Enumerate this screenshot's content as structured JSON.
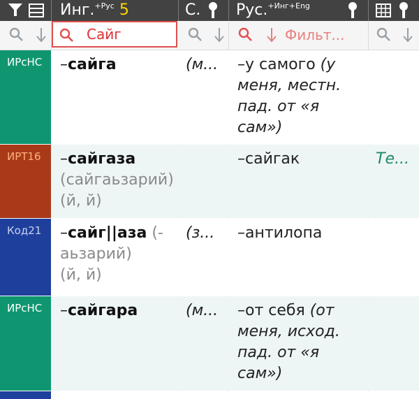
{
  "header": {
    "ing_label": "Инг.",
    "ing_sup": "+Рус",
    "count": "5",
    "src_label": "С.",
    "rus_label": "Рус.",
    "rus_sup": "+Инг+Eng"
  },
  "filters": {
    "ing_value": "Сайг",
    "rus_placeholder": "Фильт..."
  },
  "colors": {
    "header_bg": "#424242",
    "accent_count": "#ffd400",
    "filter_border": "#e05050",
    "tag_green": "#0f9670",
    "tag_brown": "#a83a1a",
    "tag_blue": "#1f3f9c",
    "row_alt_bg": "#eef5f5"
  },
  "rows": [
    {
      "tag": "ИРсНС",
      "tag_color": "#0f9670",
      "word": "сайга",
      "alt": "",
      "src": "(м...",
      "rus": "у самого",
      "rus_note": "(у меня, местн. пад. от «я сам»)",
      "ext": ""
    },
    {
      "tag": "ИРТ16",
      "tag_color": "#a83a1a",
      "word": "сайгаза",
      "alt": "(сайгаьзарий)\n(й, й)",
      "src": "",
      "rus": "сайгак",
      "rus_note": "",
      "ext": "Те..."
    },
    {
      "tag": "Код21",
      "tag_color": "#1f3f9c",
      "word": "сайг||аза",
      "alt": "(-аьзарий)\n(й, й)",
      "src": "(з...",
      "rus": "антилопа",
      "rus_note": "",
      "ext": ""
    },
    {
      "tag": "ИРсНС",
      "tag_color": "#0f9670",
      "word": "сайгара",
      "alt": "",
      "src": "(м...",
      "rus": "от себя",
      "rus_note": "(от меня, исход. пад. от «я сам»)",
      "ext": ""
    }
  ]
}
